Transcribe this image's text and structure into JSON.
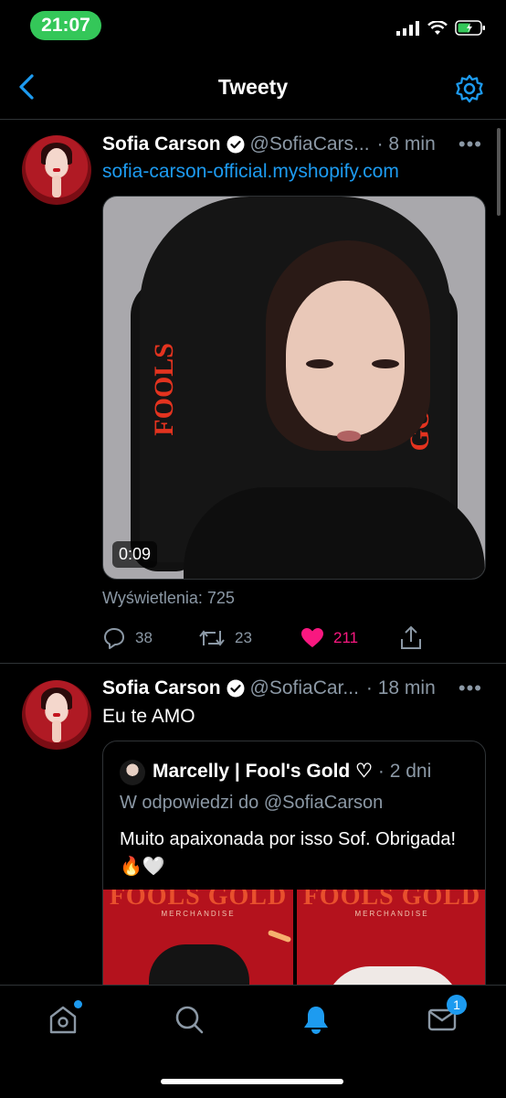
{
  "status_bar": {
    "time": "21:07"
  },
  "nav": {
    "title": "Tweety"
  },
  "tweets": [
    {
      "name": "Sofia Carson",
      "handle": "@SofiaCars...",
      "time": "· 8 min",
      "link": "sofia-carson-official.myshopify.com",
      "video_duration": "0:09",
      "views": "Wyświetlenia: 725",
      "replies": "38",
      "retweets": "23",
      "likes": "211"
    },
    {
      "name": "Sofia Carson",
      "handle": "@SofiaCar...",
      "time": "· 18 min",
      "text": "Eu te AMO",
      "quote": {
        "name": "Marcelly | Fool's Gold ♡",
        "time": "· 2 dni",
        "reply_to": "W odpowiedzi do @SofiaCarson",
        "text": "Muito apaixonada por isso Sof. Obrigada! 🔥🤍",
        "media": [
          {
            "brand": "FOOLS GOLD",
            "sub": "MERCHANDISE"
          },
          {
            "brand": "FOOLS GOLD",
            "sub": "MERCHANDISE"
          }
        ]
      }
    }
  ],
  "tabbar": {
    "notifications_badge": "1"
  },
  "colors": {
    "accent": "#1d9bf0",
    "like": "#f91880",
    "muted": "#8b98a5"
  }
}
